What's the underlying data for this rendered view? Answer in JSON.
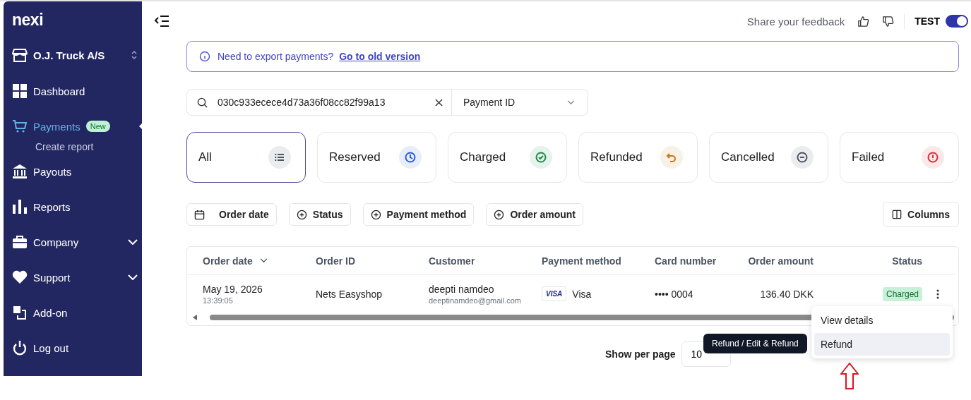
{
  "brand": {
    "logo": "nexi"
  },
  "sidebar": {
    "account": "O.J. Truck A/S",
    "items": [
      {
        "label": "Dashboard",
        "selected": false
      },
      {
        "label": "Payments",
        "selected": true,
        "badge": "New",
        "children": [
          {
            "label": "Create report",
            "selected": false
          }
        ]
      },
      {
        "label": "Payouts",
        "selected": false
      },
      {
        "label": "Reports",
        "selected": false
      },
      {
        "label": "Company",
        "selected": false,
        "expanded": false
      },
      {
        "label": "Support",
        "selected": false,
        "expanded": false
      },
      {
        "label": "Add-on",
        "selected": false
      },
      {
        "label": "Log out",
        "selected": false
      }
    ]
  },
  "header": {
    "feedback": "Share your feedback",
    "mode": {
      "label": "TEST",
      "on": true
    }
  },
  "banner": {
    "text": "Need to export payments?",
    "link": "Go to old version"
  },
  "search": {
    "value": "030c933ecece4d73a36f08cc82f99a13",
    "field": "Payment ID"
  },
  "status_tabs": [
    {
      "label": "All",
      "color": "#4b5563",
      "selected": true
    },
    {
      "label": "Reserved",
      "color": "#2f5bd8",
      "selected": false
    },
    {
      "label": "Charged",
      "color": "#1f8a4c",
      "selected": false
    },
    {
      "label": "Refunded",
      "color": "#c8761a",
      "selected": false
    },
    {
      "label": "Cancelled",
      "color": "#4b5563",
      "selected": false
    },
    {
      "label": "Failed",
      "color": "#d92d3a",
      "selected": false
    }
  ],
  "filters": [
    "Order date",
    "Status",
    "Payment method",
    "Order amount"
  ],
  "columns_button": "Columns",
  "table": {
    "columns": [
      {
        "label": "Order date",
        "sorted": true
      },
      {
        "label": "Order ID",
        "sorted": false
      },
      {
        "label": "Customer",
        "sorted": false
      },
      {
        "label": "Payment method",
        "sorted": false
      },
      {
        "label": "Card number",
        "sorted": false
      },
      {
        "label": "Order amount",
        "sorted": false
      },
      {
        "label": "Status",
        "sorted": false
      }
    ],
    "rows": [
      {
        "date": "May 19, 2026",
        "time": "13:39:05",
        "order_id": "Nets Easyshop",
        "customer": "deepti namdeo",
        "email": "deeptinamdeo@gmail.com",
        "card_brand": "VISA",
        "method": "Visa",
        "card_number": "•••• 0004",
        "amount": "136.40 DKK",
        "status": "Charged"
      }
    ]
  },
  "row_menu": {
    "items": [
      {
        "label": "View details",
        "selected": false
      },
      {
        "label": "Refund",
        "selected": true
      }
    ]
  },
  "tooltip": "Refund / Edit & Refund",
  "pagination": {
    "per_page_label": "Show per page",
    "per_page": "10"
  }
}
